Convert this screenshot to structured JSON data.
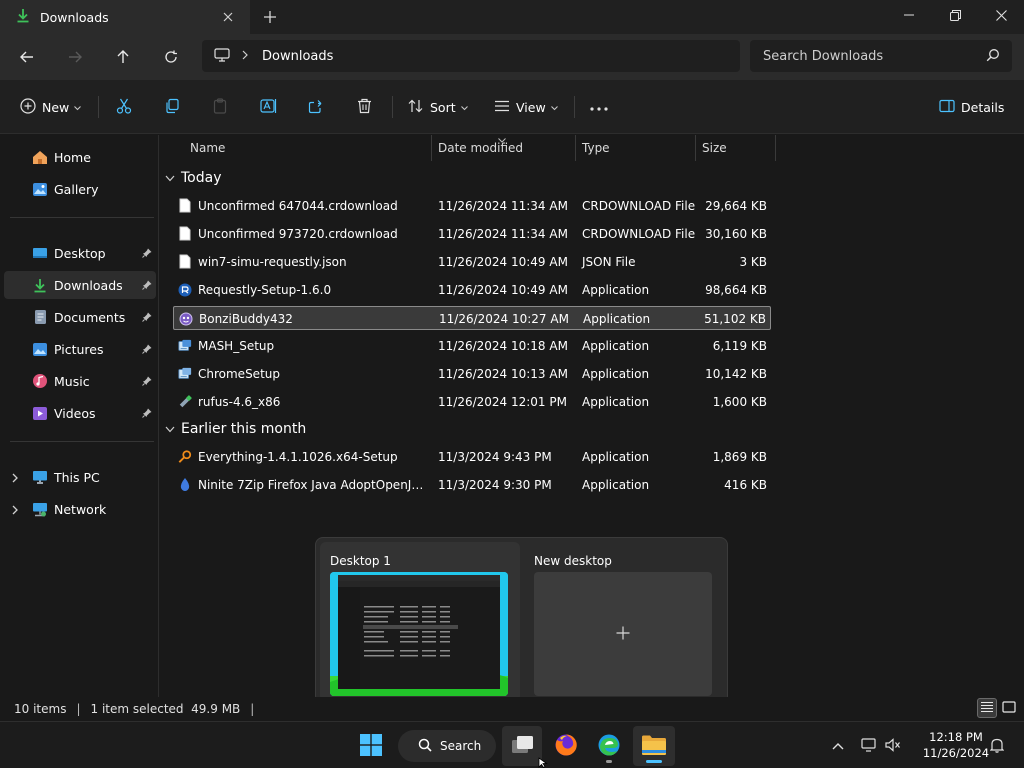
{
  "window": {
    "tab_title": "Downloads",
    "minimize_glyph": "—",
    "maximize_glyph": "❐",
    "close_glyph": "✕"
  },
  "address": {
    "current_folder": "Downloads",
    "search_placeholder": "Search Downloads"
  },
  "toolbar": {
    "new_label": "New",
    "sort_label": "Sort",
    "view_label": "View",
    "details_label": "Details"
  },
  "sidebar": {
    "items": [
      {
        "label": "Home",
        "icon": "home-icon"
      },
      {
        "label": "Gallery",
        "icon": "gallery-icon"
      },
      {
        "label": "Desktop",
        "icon": "desktop-icon"
      },
      {
        "label": "Downloads",
        "icon": "download-icon"
      },
      {
        "label": "Documents",
        "icon": "documents-icon"
      },
      {
        "label": "Pictures",
        "icon": "pictures-icon"
      },
      {
        "label": "Music",
        "icon": "music-icon"
      },
      {
        "label": "Videos",
        "icon": "videos-icon"
      },
      {
        "label": "This PC",
        "icon": "this-pc-icon"
      },
      {
        "label": "Network",
        "icon": "network-icon"
      }
    ]
  },
  "columns": {
    "name": "Name",
    "date": "Date modified",
    "type": "Type",
    "size": "Size"
  },
  "groups": [
    {
      "title": "Today",
      "files": [
        {
          "name": "Unconfirmed 647044.crdownload",
          "date": "11/26/2024 11:34 AM",
          "type": "CRDOWNLOAD File",
          "size": "29,664 KB",
          "icon": "document-icon"
        },
        {
          "name": "Unconfirmed 973720.crdownload",
          "date": "11/26/2024 11:34 AM",
          "type": "CRDOWNLOAD File",
          "size": "30,160 KB",
          "icon": "document-icon"
        },
        {
          "name": "win7-simu-requestly.json",
          "date": "11/26/2024 10:49 AM",
          "type": "JSON File",
          "size": "3 KB",
          "icon": "document-icon"
        },
        {
          "name": "Requestly-Setup-1.6.0",
          "date": "11/26/2024 10:49 AM",
          "type": "Application",
          "size": "98,664 KB",
          "icon": "requestly-icon"
        },
        {
          "name": "BonziBuddy432",
          "date": "11/26/2024 10:27 AM",
          "type": "Application",
          "size": "51,102 KB",
          "icon": "bonzi-icon",
          "selected": true
        },
        {
          "name": "MASH_Setup",
          "date": "11/26/2024 10:18 AM",
          "type": "Application",
          "size": "6,119 KB",
          "icon": "installer-icon"
        },
        {
          "name": "ChromeSetup",
          "date": "11/26/2024 10:13 AM",
          "type": "Application",
          "size": "10,142 KB",
          "icon": "installer-icon"
        },
        {
          "name": "rufus-4.6_x86",
          "date": "11/26/2024 12:01 PM",
          "type": "Application",
          "size": "1,600 KB",
          "icon": "usb-drive-icon"
        }
      ]
    },
    {
      "title": "Earlier this month",
      "files": [
        {
          "name": "Everything-1.4.1.1026.x64-Setup",
          "date": "11/3/2024 9:43 PM",
          "type": "Application",
          "size": "1,869 KB",
          "icon": "magnifier-icon"
        },
        {
          "name": "Ninite 7Zip Firefox Java AdoptOpenJDK x...",
          "date": "11/3/2024 9:30 PM",
          "type": "Application",
          "size": "416 KB",
          "icon": "ninite-icon"
        }
      ]
    }
  ],
  "virtual_desktops": {
    "current": "Desktop 1",
    "new": "New desktop",
    "new_glyph": "+"
  },
  "status": {
    "items": "10 items",
    "selection": "1 item selected  49.9 MB",
    "sep": "|"
  },
  "taskbar": {
    "search_label": "Search",
    "time": "12:18 PM",
    "date": "11/26/2024"
  },
  "colors": {
    "accent": "#4cc2ff",
    "folder": "#f2c14e"
  }
}
